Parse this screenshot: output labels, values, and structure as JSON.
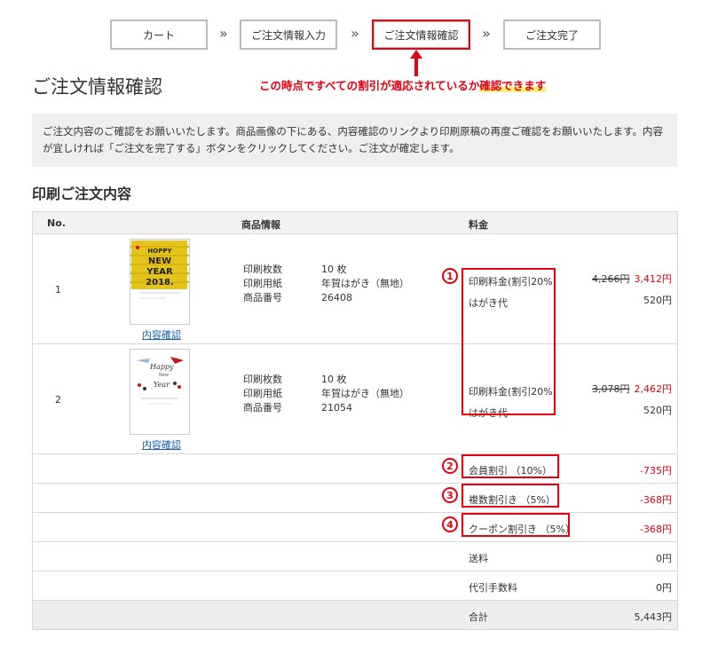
{
  "steps": [
    "カート",
    "ご注文情報入力",
    "ご注文情報確認",
    "ご注文完了"
  ],
  "step_separator": "»",
  "annotation": {
    "text": "この時点ですべての割引が適応されているか",
    "highlight": "確認できます"
  },
  "page_title": "ご注文情報確認",
  "notice": "ご注文内容のご確認をお願いいたします。商品画像の下にある、内容確認のリンクより印刷原稿の再度ご確認をお願いいたします。内容が宜しければ「ご注文を完了する」ボタンをクリックしてください。ご注文が確定します。",
  "section_title": "印刷ご注文内容",
  "table": {
    "headers": {
      "no": "No.",
      "product": "商品情報",
      "price": "料金"
    },
    "items": [
      {
        "no": "1",
        "link": "内容確認",
        "thumb_text": "HOPPY NEW YEAR 2018",
        "specs": [
          {
            "k": "印刷枚数",
            "v": "10 枚"
          },
          {
            "k": "印刷用紙",
            "v": "年賀はがき（無地）"
          },
          {
            "k": "商品番号",
            "v": "26408"
          }
        ],
        "print_fee_label": "印刷料金(割引20%)",
        "paper_fee_label": "はがき代",
        "old_price": "4,266円",
        "new_price": "3,412円",
        "paper_price": "520円"
      },
      {
        "no": "2",
        "link": "内容確認",
        "thumb_text": "Happy New Year",
        "specs": [
          {
            "k": "印刷枚数",
            "v": "10 枚"
          },
          {
            "k": "印刷用紙",
            "v": "年賀はがき（無地）"
          },
          {
            "k": "商品番号",
            "v": "21054"
          }
        ],
        "print_fee_label": "印刷料金(割引20%)",
        "paper_fee_label": "はがき代",
        "old_price": "3,078円",
        "new_price": "2,462円",
        "paper_price": "520円"
      }
    ],
    "discounts": [
      {
        "badge": "2",
        "label": "会員割引 （10%）",
        "amount": "-735円"
      },
      {
        "badge": "3",
        "label": "複数割引き （5%）",
        "amount": "-368円"
      },
      {
        "badge": "4",
        "label": "クーポン割引き （5%）",
        "amount": "-368円"
      }
    ],
    "badge1": "1",
    "shipping": {
      "label": "送料",
      "amount": "0円"
    },
    "cod_fee": {
      "label": "代引手数料",
      "amount": "0円"
    },
    "total": {
      "label": "合計",
      "amount": "5,443円"
    }
  },
  "colors": {
    "accent": "#e60012",
    "link": "#1a5fb4",
    "notice_bg": "#efefef"
  }
}
